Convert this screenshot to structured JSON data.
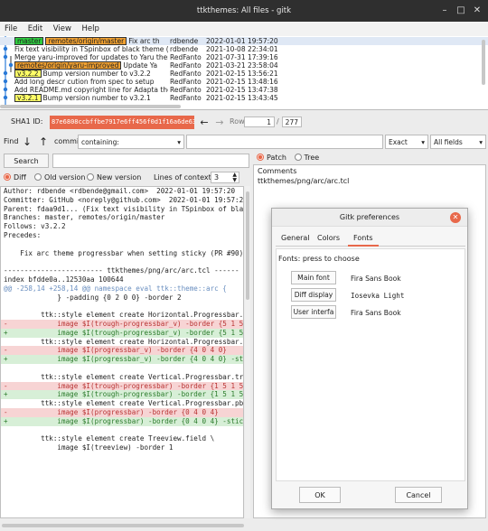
{
  "window": {
    "title": "ttkthemes: All files - gitk"
  },
  "menu": [
    "File",
    "Edit",
    "View",
    "Help"
  ],
  "commits": [
    {
      "tags": [
        "master",
        "remotes/origin/master"
      ],
      "msg": "Fix arc th",
      "author": "rdbende",
      "date": "2022-01-01 19:57:20"
    },
    {
      "tags": [],
      "msg": "Fix text visibility in TSpinbox of black theme (PR",
      "author": "rdbende",
      "date": "2021-10-08 22:34:01"
    },
    {
      "tags": [],
      "msg": "Merge yaru-improved for updates to Yaru theme",
      "author": "RedFanto",
      "date": "2021-07-31 17:39:16"
    },
    {
      "tags": [
        "remotes/origin/yaru-improved"
      ],
      "msg": "Update Ya",
      "author": "RedFanto",
      "date": "2021-03-21 23:58:04"
    },
    {
      "tags": [
        "v3.2.2"
      ],
      "msg": "Bump version number to v3.2.2",
      "author": "RedFanto",
      "date": "2021-02-15 13:56:21"
    },
    {
      "tags": [],
      "msg": "Add long descr cution from spec to setup",
      "author": "RedFanto",
      "date": "2021-02-15 13:48:16"
    },
    {
      "tags": [],
      "msg": "Add README.md copyright line for Adapta theme",
      "author": "RedFanto",
      "date": "2021-02-15 13:47:38"
    },
    {
      "tags": [
        "v3.2.1"
      ],
      "msg": "Bump version number to v3.2.1",
      "author": "RedFanto",
      "date": "2021-02-15 13:43:45"
    }
  ],
  "sha": {
    "label": "SHA1 ID:",
    "value": "87e6808ccbffbe7917e6ff456f0d1f16a6de638",
    "row_label": "Row",
    "row_current": "1",
    "row_total": "277"
  },
  "find": {
    "label": "Find",
    "mode": "commit",
    "field": "containing:",
    "match": "Exact",
    "scope": "All fields"
  },
  "search": {
    "button": "Search"
  },
  "diff_options": {
    "diff": "Diff",
    "old": "Old version",
    "new": "New version",
    "context_label": "Lines of context:",
    "context_value": "3"
  },
  "view_options": {
    "patch": "Patch",
    "tree": "Tree"
  },
  "files": {
    "header": "Comments",
    "items": [
      "ttkthemes/png/arc/arc.tcl"
    ]
  },
  "diff_lines": [
    {
      "t": "n",
      "s": "Author: rdbende <rdbende@gmail.com>  2022-01-01 19:57:20"
    },
    {
      "t": "n",
      "s": "Committer: GitHub <noreply@github.com>  2022-01-01 19:57:20"
    },
    {
      "t": "n",
      "s": "Parent: fdaa9d1... (Fix text visibility in TSpinbox of black"
    },
    {
      "t": "n",
      "s": "Branches: master, remotes/origin/master"
    },
    {
      "t": "n",
      "s": "Follows: v3.2.2"
    },
    {
      "t": "n",
      "s": "Precedes:"
    },
    {
      "t": "n",
      "s": ""
    },
    {
      "t": "n",
      "s": "    Fix arc theme progressbar when setting sticky (PR #90)"
    },
    {
      "t": "n",
      "s": ""
    },
    {
      "t": "n",
      "s": "------------------------ ttkthemes/png/arc/arc.tcl ------"
    },
    {
      "t": "n",
      "s": "index bfdde0a..12530aa 100644"
    },
    {
      "t": "link",
      "s": "@@ -258,14 +258,14 @@ namespace eval ttk::theme::arc {"
    },
    {
      "t": "n",
      "s": "             } -padding {0 2 0 0} -border 2"
    },
    {
      "t": "n",
      "s": ""
    },
    {
      "t": "n",
      "s": "         ttk::style element create Horizontal.Progressbar.trough \\"
    },
    {
      "t": "del",
      "s": "-            image $I(trough-progressbar_v) -border {5 1 5 1} -padd"
    },
    {
      "t": "add",
      "s": "+            image $I(trough-progressbar_v) -border {5 1 5 1} -padd"
    },
    {
      "t": "n",
      "s": "         ttk::style element create Horizontal.Progressbar.pbar \\"
    },
    {
      "t": "del",
      "s": "-            image $I(progressbar_v) -border {4 0 4 0}"
    },
    {
      "t": "add",
      "s": "+            image $I(progressbar_v) -border {4 0 4 0} -sticky ew"
    },
    {
      "t": "n",
      "s": ""
    },
    {
      "t": "n",
      "s": "         ttk::style element create Vertical.Progressbar.trough \\"
    },
    {
      "t": "del",
      "s": "-            image $I(trough-progressbar) -border {1 5 1 5} -paddin"
    },
    {
      "t": "add",
      "s": "+            image $I(trough-progressbar) -border {1 5 1 5} -paddin"
    },
    {
      "t": "n",
      "s": "         ttk::style element create Vertical.Progressbar.pbar \\"
    },
    {
      "t": "del",
      "s": "-            image $I(progressbar) -border {0 4 0 4}"
    },
    {
      "t": "add",
      "s": "+            image $I(progressbar) -border {0 4 0 4} -sticky ns"
    },
    {
      "t": "n",
      "s": ""
    },
    {
      "t": "n",
      "s": "         ttk::style element create Treeview.field \\"
    },
    {
      "t": "n",
      "s": "             image $I(treeview) -border 1"
    },
    {
      "t": "n",
      "s": ""
    }
  ],
  "dialog": {
    "title": "Gitk preferences",
    "tabs": [
      "General",
      "Colors",
      "Fonts"
    ],
    "heading": "Fonts: press to choose",
    "fonts": [
      {
        "button": "Main font",
        "value": "Fira Sans Book"
      },
      {
        "button": "Diff display",
        "value": "Iosevka Light"
      },
      {
        "button": "User interfa",
        "value": "Fira Sans Book"
      }
    ],
    "ok": "OK",
    "cancel": "Cancel"
  },
  "colors": {
    "accent": "#e8684a",
    "tag_local": "#2ecc40",
    "tag_remote": "#f0a030",
    "tag_version": "#ffff66"
  }
}
